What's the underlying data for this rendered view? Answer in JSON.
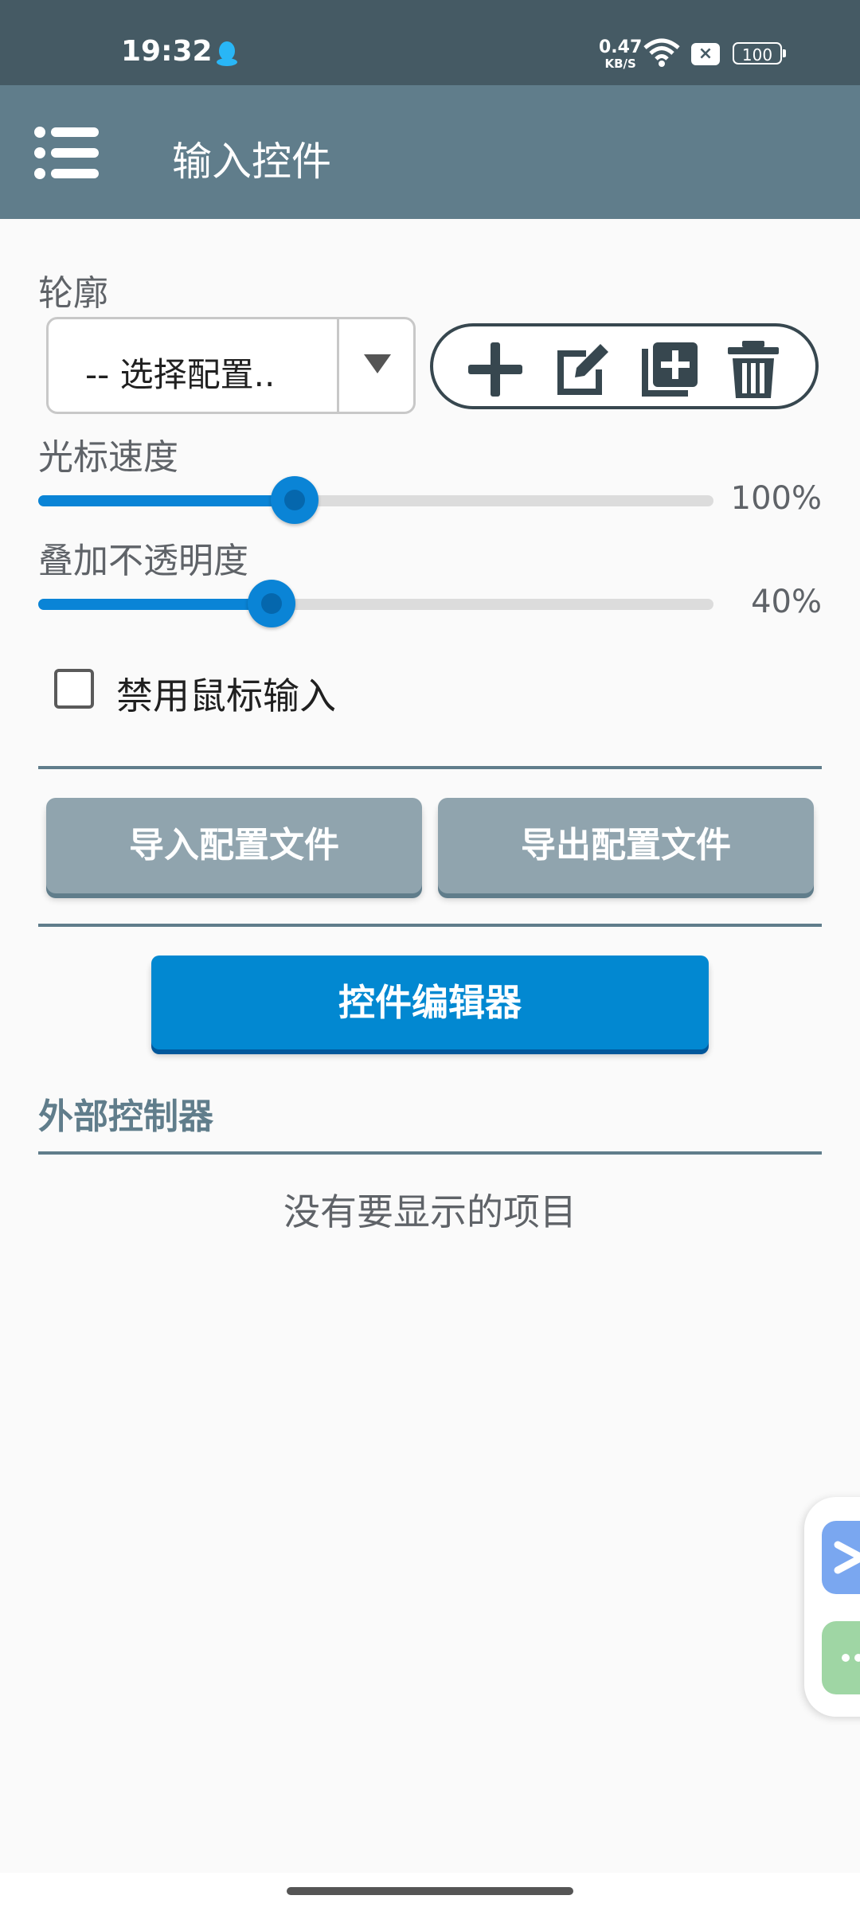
{
  "status_bar": {
    "time": "19:32",
    "net_speed_value": "0.47",
    "net_speed_unit": "KB/S",
    "battery": "100",
    "notif_badge": "×"
  },
  "app_bar": {
    "title": "输入控件"
  },
  "profile": {
    "label": "轮廓",
    "selected": "-- 选择配置..",
    "actions": [
      "add-icon",
      "edit-icon",
      "duplicate-icon",
      "delete-icon"
    ]
  },
  "cursor_speed": {
    "label": "光标速度",
    "value_text": "100%",
    "fraction": 0.38
  },
  "overlay_opacity": {
    "label": "叠加不透明度",
    "value_text": "40%",
    "fraction": 0.345
  },
  "disable_mouse": {
    "label": "禁用鼠标输入",
    "checked": false
  },
  "buttons": {
    "import": "导入配置文件",
    "export": "导出配置文件",
    "editor": "控件编辑器"
  },
  "external": {
    "label": "外部控制器",
    "empty_text": "没有要显示的项目"
  },
  "colors": {
    "status_bar": "#455a64",
    "app_bar": "#607d8b",
    "accent": "#0288d1",
    "gray_button": "#90a4ae"
  }
}
